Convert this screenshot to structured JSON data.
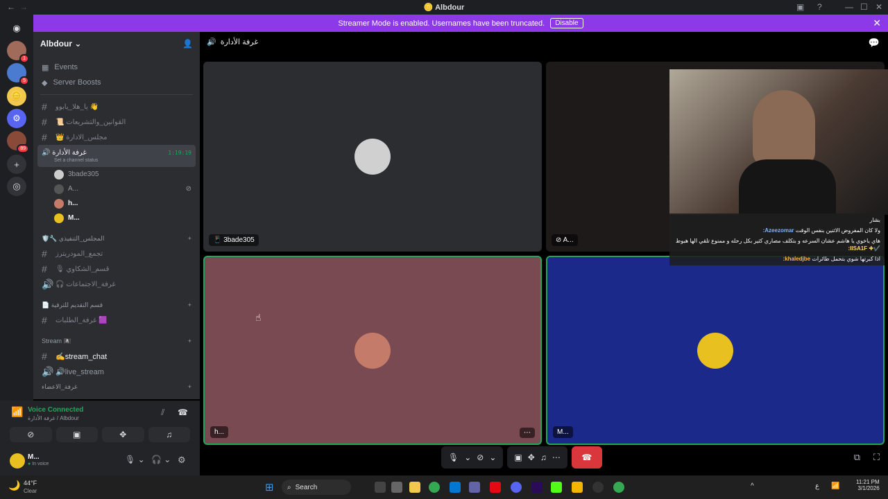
{
  "window": {
    "title": "Albdour"
  },
  "banner": {
    "text": "Streamer Mode is enabled. Usernames have been truncated.",
    "button": "Disable"
  },
  "servers": [
    {
      "badge": "1"
    },
    {
      "badge": "5"
    },
    {
      "badge": ""
    },
    {
      "badge": ""
    },
    {
      "badge": "89"
    }
  ],
  "sidebar": {
    "guild": "Albdour",
    "nav": [
      {
        "label": "Events"
      },
      {
        "label": "Server Boosts"
      }
    ],
    "channels_top": [
      "يا_هلا_يابوو 👋",
      "📜 القوانين_والتشريعات",
      "👑 مجلس_الادارة"
    ],
    "voice_channel": {
      "name": "غرفة الأدارة",
      "timer": "1:19:19",
      "status": "Set a channel status"
    },
    "voice_users": [
      "3bade305",
      "A...",
      "h...",
      "M..."
    ],
    "cat1": "🛡️🔧 المجلس_التنفيذي",
    "cat1_channels": [
      "تجمع_المودريترز",
      "🎙 قسم_الشكاوي",
      "🎧 غرفة_الاجتماعات"
    ],
    "cat2": "📄 قسم التقديم للترقية",
    "cat2_channels": [
      "غرفة_الطلبات 🟪"
    ],
    "cat3": "Stream 🏴‍☠️",
    "cat3_channels": [
      "✍️stream_chat",
      "🔊live_stream"
    ],
    "cat4": "غرفة_الاعضاء"
  },
  "voice": {
    "status": "Voice Connected",
    "location": "غرفة الأدارة / Albdour"
  },
  "me": {
    "name": "M...",
    "status": "In voice"
  },
  "main": {
    "channel": "غرفة الأدارة",
    "tiles": [
      {
        "name": "3bade305",
        "bg": "#2b2d31",
        "avatar": "#d0d0d0"
      },
      {
        "name": "A...",
        "bg": "#2b2d31",
        "avatar": "#555"
      },
      {
        "name": "h...",
        "bg": "#7a4a53",
        "avatar": "#c47b6a"
      },
      {
        "name": "M...",
        "bg": "#1b2a8a",
        "avatar": "#e8c020"
      }
    ],
    "overlay_chat": [
      {
        "author": "",
        "text": "بشار"
      },
      {
        "author": "Azeezomar:",
        "text": "ولا كان المفروض الاثنين بنفس الوقت"
      },
      {
        "author": "✔️✚ IISA1F:",
        "text": "هاي ياخوي يا هاشم عشان السرعه و بتكلف مصاري كثير بكل رحله و ممنوع تلقي الها هبوط"
      },
      {
        "author": "khaledjbe:",
        "text": "اذا كبرتها شوي بتحمل طائرات"
      }
    ]
  },
  "taskbar": {
    "weather_temp": "44°F",
    "weather_desc": "Clear",
    "search": "Search",
    "time": "11:21 PM",
    "date": "3/1/2026",
    "lang": "ع"
  }
}
